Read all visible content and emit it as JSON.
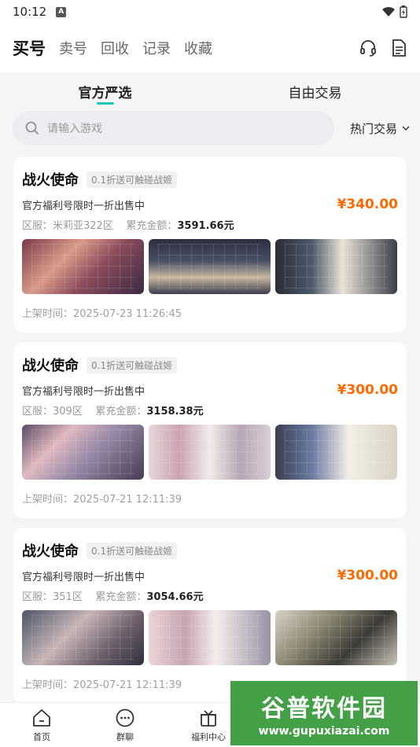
{
  "status_bar": {
    "time": "10:12"
  },
  "top_nav": {
    "tabs": [
      {
        "label": "买号",
        "active": true
      },
      {
        "label": "卖号",
        "active": false
      },
      {
        "label": "回收",
        "active": false
      },
      {
        "label": "记录",
        "active": false
      },
      {
        "label": "收藏",
        "active": false
      }
    ],
    "icons": [
      "headset-icon",
      "document-icon"
    ]
  },
  "sub_tabs": [
    {
      "label": "官方严选",
      "active": true
    },
    {
      "label": "自由交易",
      "active": false
    }
  ],
  "search": {
    "placeholder": "请输入游戏",
    "filter_label": "热门交易"
  },
  "listings": [
    {
      "title": "战火使命",
      "tag": "0.1折送可触碰战姬",
      "desc": "官方福利号限时一折出售中",
      "price": "¥340.00",
      "server": "区服：米莉亚322区",
      "recharge_label": "累充金额：",
      "recharge_value": "3591.66元",
      "time": "上架时间：2025-07-23 11:26:45"
    },
    {
      "title": "战火使命",
      "tag": "0.1折送可触碰战姬",
      "desc": "官方福利号限时一折出售中",
      "price": "¥300.00",
      "server": "区服：309区",
      "recharge_label": "累充金额：",
      "recharge_value": "3158.38元",
      "time": "上架时间：2025-07-21 12:11:39"
    },
    {
      "title": "战火使命",
      "tag": "0.1折送可触碰战姬",
      "desc": "官方福利号限时一折出售中",
      "price": "¥300.00",
      "server": "区服：351区",
      "recharge_label": "累充金额：",
      "recharge_value": "3054.66元",
      "time": "上架时间：2025-07-21 12:11:39"
    }
  ],
  "bottom_nav": [
    {
      "label": "首页",
      "icon": "home-icon"
    },
    {
      "label": "群聊",
      "icon": "chat-icon"
    },
    {
      "label": "福利中心",
      "icon": "gift-icon"
    },
    {
      "label": "",
      "icon": "trade-icon"
    },
    {
      "label": "",
      "icon": "profile-icon"
    }
  ],
  "watermark": {
    "text": "谷普软件园",
    "url": "www.gupuxiazai.com"
  },
  "colors": {
    "accent": "#1cc7b6",
    "price": "#ff6a00",
    "watermark": "#43a047"
  }
}
